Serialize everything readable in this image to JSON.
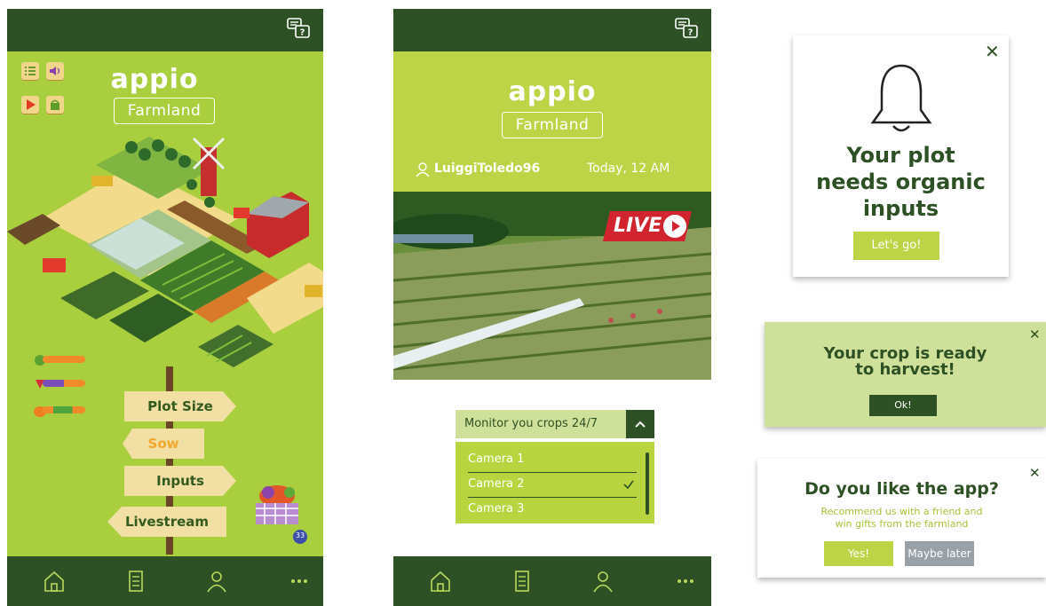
{
  "colors": {
    "dark_green": "#2d5124",
    "lime": "#a9cf3f",
    "lime_header": "#bcd445",
    "card_green": "#cfe09a"
  },
  "app": {
    "logo_text": "appio",
    "subtitle": "Farmland"
  },
  "phone1": {
    "icons": [
      "list-icon",
      "speaker-icon",
      "play-icon",
      "basket-icon"
    ],
    "signs": {
      "plot_size": "Plot Size",
      "sow": "Sow",
      "inputs": "Inputs",
      "livestream": "Livestream"
    },
    "cart_badge": "33",
    "nav": [
      "home-icon",
      "document-icon",
      "profile-icon",
      "more-icon"
    ]
  },
  "phone2": {
    "username": "LuiggiToledo96",
    "timestamp": "Today, 12 AM",
    "live_label": "LIVE",
    "dropdown_label": "Monitor you crops 24/7",
    "cameras": [
      {
        "label": "Camera 1",
        "selected": false
      },
      {
        "label": "Camera 2",
        "selected": true
      },
      {
        "label": "Camera 3",
        "selected": false
      }
    ]
  },
  "notifications": {
    "organic": {
      "title_line1": "Your plot",
      "title_line2": "needs organic",
      "title_line3": "inputs",
      "button": "Let's go!"
    },
    "harvest": {
      "title_line1": "Your crop is ready",
      "title_line2": "to harvest!",
      "button": "Ok!"
    },
    "rate": {
      "title": "Do you like the app?",
      "body_line1": "Recommend us with a friend and",
      "body_line2": "win gifts from the farmland",
      "yes": "Yes!",
      "later": "Maybe later"
    }
  }
}
